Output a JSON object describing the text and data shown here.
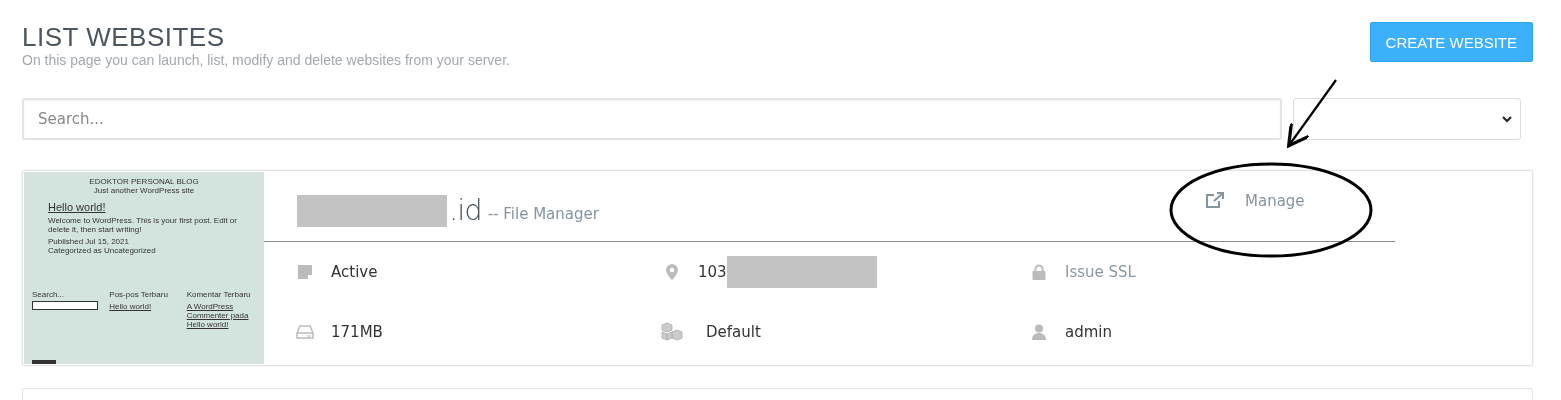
{
  "header": {
    "title": "LIST WEBSITES",
    "subtitle": "On this page you can launch, list, modify and delete websites from your server.",
    "create_button": "CREATE WEBSITE"
  },
  "search": {
    "placeholder": "Search..."
  },
  "websites": [
    {
      "preview": {
        "site_title": "EDOKTOR PERSONAL BLOG",
        "tagline": "Just another WordPress site",
        "post_title": "Hello world!",
        "post_body": "Welcome to WordPress. This is your first post. Edit or delete it, then start writing!",
        "published": "Published Jul 15, 2021",
        "category": "Categorized as Uncategorized",
        "search_label": "Search...",
        "recent_posts_title": "Pos-pos Terbaru",
        "recent_post": "Hello world!",
        "recent_comments_title": "Komentar Terbaru",
        "recent_comment": "A WordPress Commenter pada Hello world!"
      },
      "domain": ".id",
      "domain_redacted": true,
      "file_manager": "-- File Manager",
      "manage": "Manage",
      "details": [
        {
          "kind": "state",
          "text": "Active",
          "redacted": false
        },
        {
          "kind": "ip",
          "text": "103",
          "redacted": true
        },
        {
          "kind": "ssl",
          "text": "Issue SSL",
          "redacted": false
        },
        {
          "kind": "disk",
          "text": "171MB",
          "redacted": false
        },
        {
          "kind": "package",
          "text": "Default",
          "redacted": false
        },
        {
          "kind": "owner",
          "text": "admin",
          "redacted": false
        }
      ]
    }
  ]
}
